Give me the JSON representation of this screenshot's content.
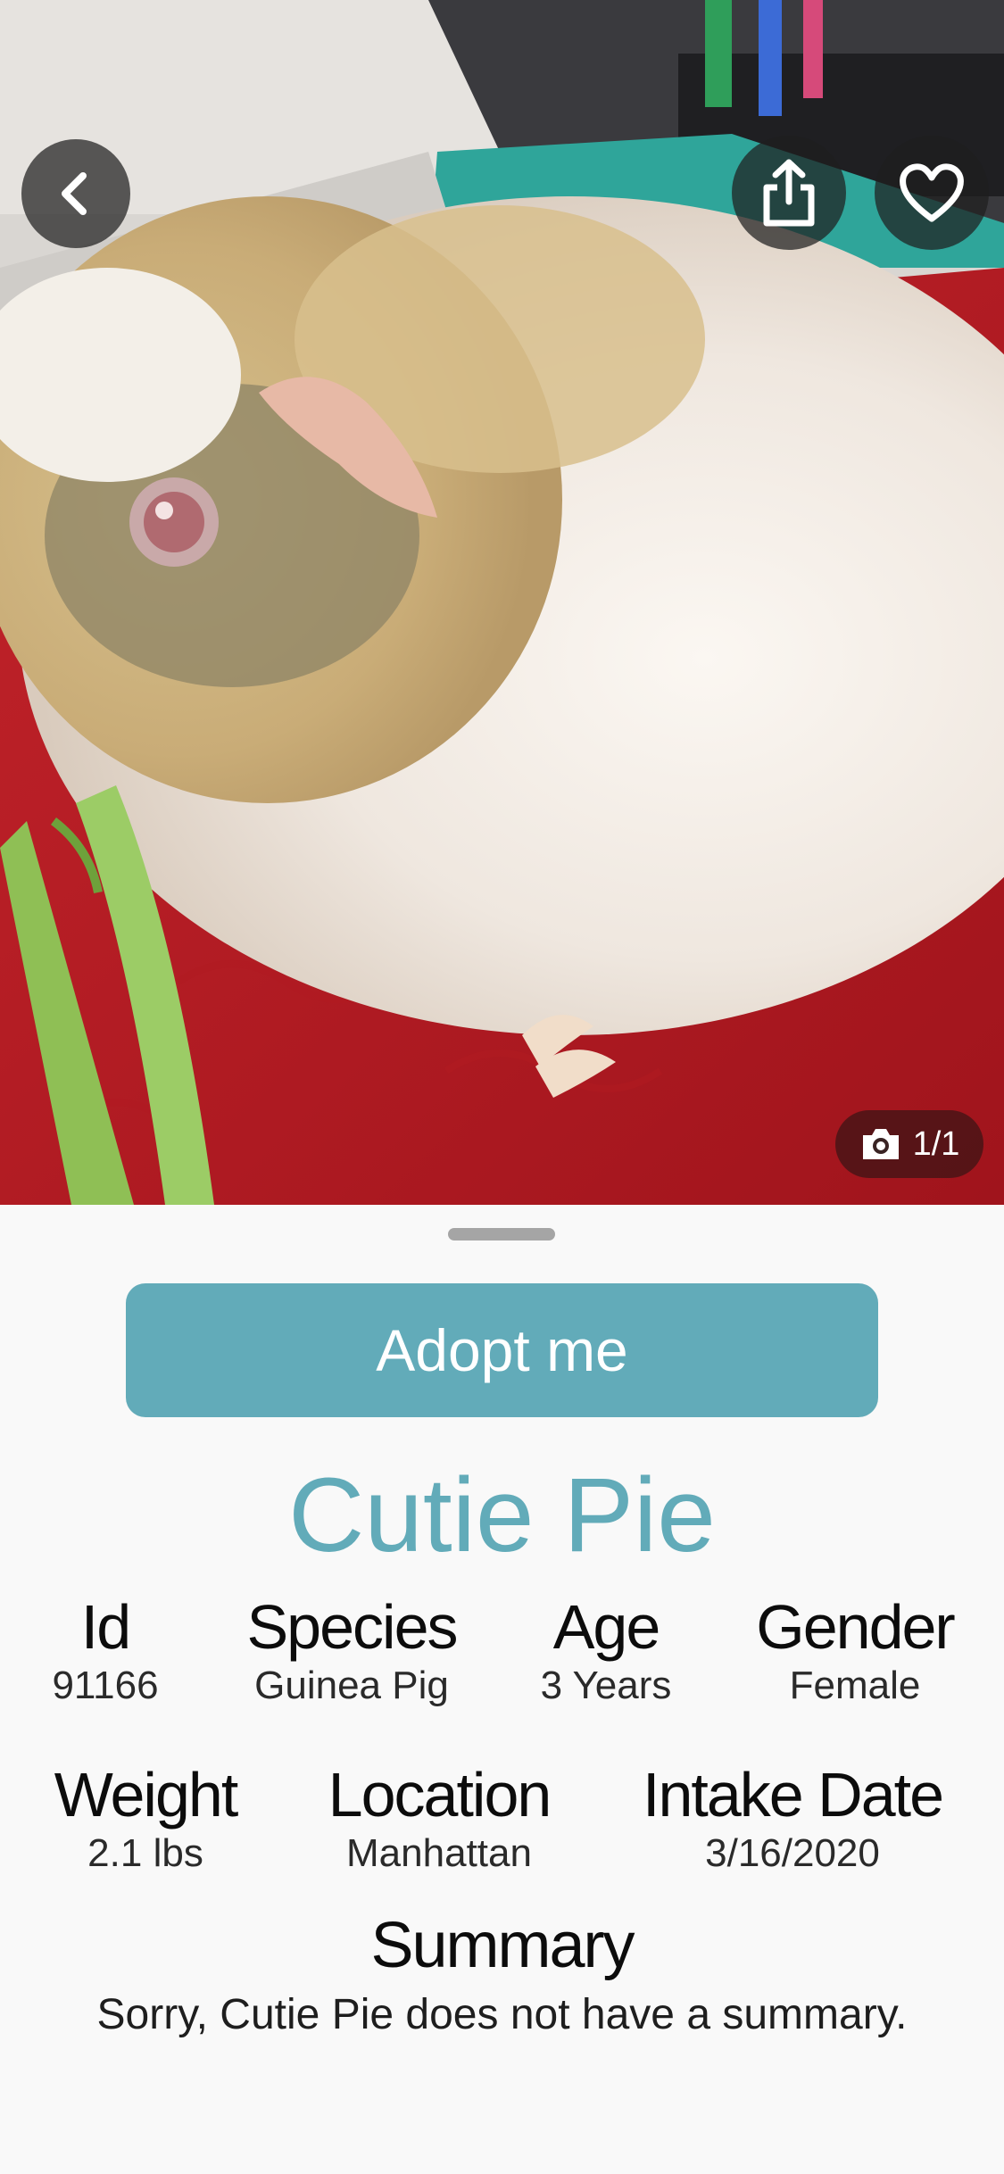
{
  "photo": {
    "subject": "guinea-pig-photo",
    "counter": "1/1"
  },
  "actions": {
    "back_icon": "chevron-left-icon",
    "share_icon": "share-icon",
    "favorite_icon": "heart-icon",
    "camera_icon": "camera-icon"
  },
  "adopt_button": "Adopt me",
  "pet": {
    "name": "Cutie Pie",
    "fields": {
      "id": {
        "label": "Id",
        "value": "91166"
      },
      "species": {
        "label": "Species",
        "value": "Guinea Pig"
      },
      "age": {
        "label": "Age",
        "value": "3 Years"
      },
      "gender": {
        "label": "Gender",
        "value": "Female"
      },
      "weight": {
        "label": "Weight",
        "value": "2.1 lbs"
      },
      "location": {
        "label": "Location",
        "value": "Manhattan"
      },
      "intake_date": {
        "label": "Intake Date",
        "value": "3/16/2020"
      }
    },
    "summary": {
      "title": "Summary",
      "text": "Sorry, Cutie Pie does not have a summary."
    }
  },
  "colors": {
    "accent": "#62abb9",
    "sheet_background": "#f9f9f9"
  }
}
